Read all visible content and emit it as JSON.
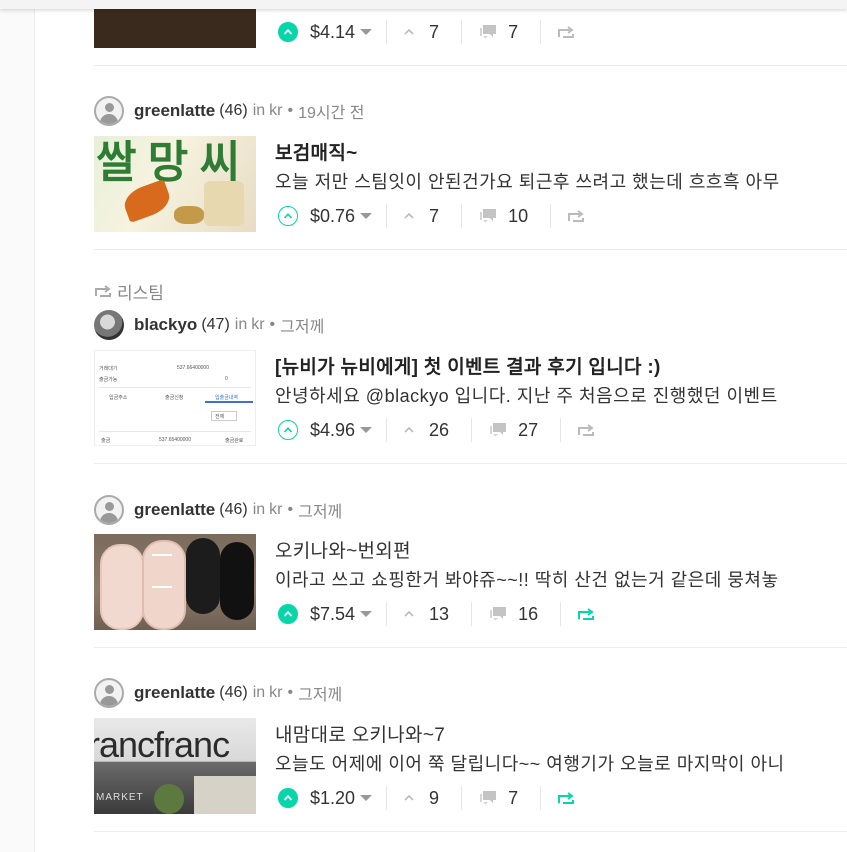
{
  "posts": [
    {
      "author": "",
      "title": "",
      "summary": "",
      "payout": "$4.14",
      "votes": "7",
      "comments": "7",
      "voted": true,
      "resteemed": false
    },
    {
      "author": "greenlatte",
      "reputation": "(46)",
      "in": "in",
      "category": "kr",
      "time": "19시간 전",
      "title": "보검매직~",
      "summary": "오늘 저만 스팀잇이 안된건가요 퇴근후 쓰려고 했는데 흐흐흑 아무",
      "payout": "$0.76",
      "votes": "7",
      "comments": "10",
      "voted": false,
      "resteemed": false
    },
    {
      "resteem_label": "리스팀",
      "author": "blackyo",
      "reputation": "(47)",
      "in": "in",
      "category": "kr",
      "time": "그저께",
      "title": "[뉴비가 뉴비에게] 첫 이벤트 결과 후기 입니다 :)",
      "summary": "안녕하세요 @blackyo 입니다. 지난 주 처음으로 진행했던 이벤트",
      "payout": "$4.96",
      "votes": "26",
      "comments": "27",
      "voted": false,
      "resteemed": false
    },
    {
      "author": "greenlatte",
      "reputation": "(46)",
      "in": "in",
      "category": "kr",
      "time": "그저께",
      "title": "오키나와~번외편",
      "summary": "이라고 쓰고 쇼핑한거 봐야쥬~~!! 딱히 산건 없는거 같은데 뭉쳐놓",
      "payout": "$7.54",
      "votes": "13",
      "comments": "16",
      "voted": true,
      "resteemed": true
    },
    {
      "author": "greenlatte",
      "reputation": "(46)",
      "in": "in",
      "category": "kr",
      "time": "그저께",
      "title": "내맘대로 오키나와~7",
      "summary": "오늘도 어제에 이어 쭉 달립니다~~ 여행기가 오늘로 마지막이 아니",
      "payout": "$1.20",
      "votes": "9",
      "comments": "7",
      "voted": true,
      "resteemed": true
    }
  ],
  "thumb_text": {
    "store_sign": "rancfranc",
    "store_market": "MARKET",
    "bag_text": "쌀 망 씨",
    "table_lines": [
      "거래대기",
      "537.66400000",
      "출금가능",
      "0",
      "입금주소",
      "출금신청",
      "입출금내역",
      "전체",
      "출금",
      "537.65400000",
      "출금완료"
    ]
  },
  "colors": {
    "accent": "#06d6a9",
    "muted": "#888888",
    "text": "#333333"
  }
}
